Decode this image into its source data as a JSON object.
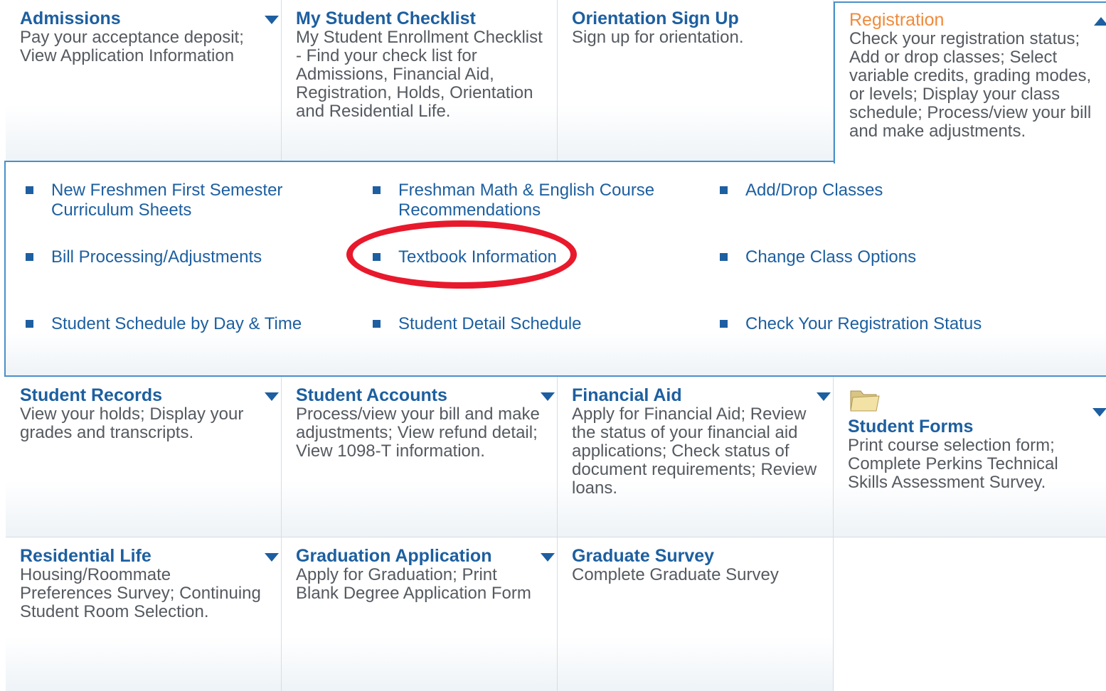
{
  "tiles": {
    "admissions": {
      "title": "Admissions",
      "desc": "Pay your acceptance deposit; View Application Information"
    },
    "checklist": {
      "title": "My Student Checklist",
      "desc": "My Student Enrollment Checklist - Find your check list for Admissions, Financial Aid, Registration, Holds, Orientation and Residential Life."
    },
    "orientation": {
      "title": "Orientation Sign Up",
      "desc": "Sign up for orientation."
    },
    "registration": {
      "title": "Registration",
      "desc": "Check your registration status; Add or drop classes; Select variable credits, grading modes, or levels; Display your class schedule; Process/view your bill and make adjustments."
    },
    "records": {
      "title": "Student Records",
      "desc": "View your holds; Display your grades and transcripts."
    },
    "accounts": {
      "title": "Student Accounts",
      "desc": "Process/view your bill and make adjustments; View refund detail; View 1098-T information."
    },
    "financial_aid": {
      "title": "Financial Aid",
      "desc": "Apply for Financial Aid; Review the status of your financial aid applications; Check status of document requirements; Review loans."
    },
    "forms": {
      "title": "Student Forms",
      "desc": "Print course selection form; Complete Perkins Technical Skills Assessment Survey."
    },
    "residential": {
      "title": "Residential Life",
      "desc": "Housing/Roommate Preferences Survey; Continuing Student Room Selection."
    },
    "graduation_app": {
      "title": "Graduation Application",
      "desc": "Apply for Graduation; Print Blank Degree Application Form"
    },
    "graduate_survey": {
      "title": "Graduate Survey",
      "desc": "Complete Graduate Survey"
    }
  },
  "registration_links": {
    "curriculum": "New Freshmen First Semester Curriculum Sheets",
    "math_english": "Freshman Math & English Course Recommendations",
    "add_drop": "Add/Drop Classes",
    "bill": "Bill Processing/Adjustments",
    "textbook": "Textbook Information",
    "change_options": "Change Class Options",
    "schedule_day_time": "Student Schedule by Day & Time",
    "detail_schedule": "Student Detail Schedule",
    "reg_status": "Check Your Registration Status"
  },
  "colors": {
    "link_blue": "#1d5fa0",
    "active_orange": "#f08a3a",
    "panel_border": "#4a8fc9",
    "highlight_red": "#e8192c"
  },
  "icons": {
    "tile_toggle": "chevron-down-icon",
    "open_tile_toggle": "chevron-up-icon",
    "forms_tile": "folder-icon",
    "list_bullet": "square-bullet-icon"
  }
}
